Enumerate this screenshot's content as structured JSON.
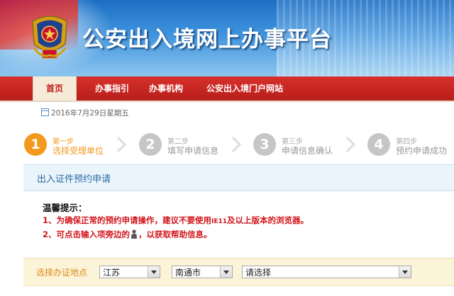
{
  "banner": {
    "title": "公安出入境网上办事平台"
  },
  "nav": {
    "items": [
      "首页",
      "办事指引",
      "办事机构",
      "公安出入境门户网站"
    ]
  },
  "date": {
    "text": "2016年7月29日星期五"
  },
  "steps": [
    {
      "num": "1",
      "small": "第一步",
      "label": "选择受理单位",
      "active": true
    },
    {
      "num": "2",
      "small": "第二步",
      "label": "填写申请信息",
      "active": false
    },
    {
      "num": "3",
      "small": "第三步",
      "label": "申请信息确认",
      "active": false
    },
    {
      "num": "4",
      "small": "第四步",
      "label": "预约申请成功",
      "active": false
    }
  ],
  "form": {
    "title": "出入证件预约申请"
  },
  "notice": {
    "title": "温馨提示：",
    "line1_a": "1、为确保正常的预约申请操作，建议不要使用",
    "line1_ie": "IE11",
    "line1_b": "及以上版本的浏览器。",
    "line2_a": "2、可点击输入项旁边的",
    "line2_b": "，以获取帮助信息。"
  },
  "location": {
    "label": "选择办证地点",
    "province": "江苏",
    "city": "南通市",
    "office": "请选择"
  },
  "colors": {
    "nav_red": "#c8241f",
    "step_active": "#f39a1d",
    "notice_red": "#d2141a",
    "accent_blue": "#2b6aa6"
  }
}
